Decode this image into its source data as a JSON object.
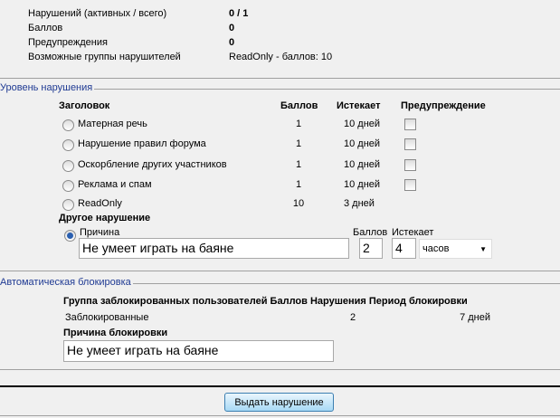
{
  "summary": {
    "rows": [
      {
        "label": "Нарушений (активных / всего)",
        "value": "0 / 1",
        "bold": true
      },
      {
        "label": "Баллов",
        "value": "0",
        "bold": true
      },
      {
        "label": "Предупреждения",
        "value": "0",
        "bold": true
      },
      {
        "label": "Возможные группы нарушителей",
        "value": "ReadOnly - баллов: 10",
        "bold": false
      }
    ]
  },
  "level": {
    "legend": "Уровень нарушения",
    "headers": {
      "title": "Заголовок",
      "points": "Баллов",
      "expires": "Истекает",
      "warning": "Предупреждение"
    },
    "rows": [
      {
        "label": "Матерная речь",
        "points": "1",
        "expires": "10 дней",
        "checkbox": true
      },
      {
        "label": "Нарушение правил форума",
        "points": "1",
        "expires": "10 дней",
        "checkbox": true
      },
      {
        "label": "Оскорбление других участников",
        "points": "1",
        "expires": "10 дней",
        "checkbox": true
      },
      {
        "label": "Реклама и спам",
        "points": "1",
        "expires": "10 дней",
        "checkbox": true
      },
      {
        "label": "ReadOnly",
        "points": "10",
        "expires": "3 дней",
        "checkbox": false
      }
    ],
    "other": {
      "title": "Другое нарушение",
      "reason_label": "Причина",
      "reason_value": "Не умеет играть на баяне",
      "points_label": "Баллов",
      "points_value": "2",
      "expires_label": "Истекает",
      "expires_value": "4",
      "unit": "часов"
    }
  },
  "auto": {
    "legend": "Автоматическая блокировка",
    "headers": "Группа заблокированных пользователей Баллов Нарушения Период блокировки",
    "group": "Заблокированные",
    "points": "2",
    "period": "7 дней",
    "reason_title": "Причина блокировки",
    "reason_value": "Не умеет играть на баяне"
  },
  "submit_label": "Выдать нарушение"
}
